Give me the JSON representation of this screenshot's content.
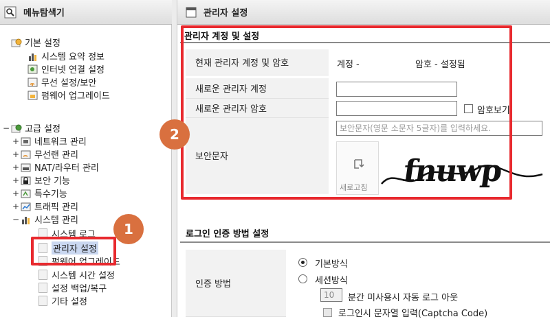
{
  "sidebar": {
    "title": "메뉴탐색기",
    "basic": {
      "label": "기본 설정",
      "items": [
        "시스템 요약 정보",
        "인터넷 연결 설정",
        "무선 설정/보안",
        "펌웨어 업그레이드"
      ]
    },
    "advanced": {
      "toggle": "−",
      "label": "고급 설정",
      "groups": [
        {
          "toggle": "+",
          "label": "네트워크 관리"
        },
        {
          "toggle": "+",
          "label": "무선랜 관리"
        },
        {
          "toggle": "+",
          "label": "NAT/라우터 관리"
        },
        {
          "toggle": "+",
          "label": "보안 기능"
        },
        {
          "toggle": "+",
          "label": "특수기능"
        },
        {
          "toggle": "+",
          "label": "트래픽 관리"
        },
        {
          "toggle": "−",
          "label": "시스템 관리"
        }
      ],
      "system_items": [
        "시스템 로그",
        "관리자 설정",
        "펌웨어 업그레이드",
        "시스템 시간 설정",
        "설정 백업/복구",
        "기타 설정"
      ]
    }
  },
  "main": {
    "header_title": "관리자 설정",
    "account_section": {
      "title": "관리자 계정 및 설정",
      "current_label": "현재 관리자 계정 및 암호",
      "current_account": "계정 -",
      "current_password": "암호 - 설정됨",
      "new_account_label": "새로운 관리자 계정",
      "new_account_value": "",
      "new_password_label": "새로운 관리자 암호",
      "new_password_value": "",
      "show_password_label": "암호보기",
      "captcha_label": "보안문자",
      "captcha_placeholder": "보안문자(영문 소문자 5글자)를 입력하세요.",
      "refresh_label": "새로고침",
      "captcha_text": "fnuwp"
    },
    "login_section": {
      "title": "로그인 인증 방법 설정",
      "auth_label": "인증 방법",
      "option_basic": "기본방식",
      "option_session": "세션방식",
      "timeout_value": "10",
      "timeout_suffix": "분간 미사용시 자동 로그 아웃",
      "captcha_option": "로그인시 문자열 입력(Captcha Code)"
    }
  },
  "annotations": {
    "badge1": "1",
    "badge2": "2",
    "highlight_color": "#e8292e",
    "badge_color": "#d9703f"
  }
}
